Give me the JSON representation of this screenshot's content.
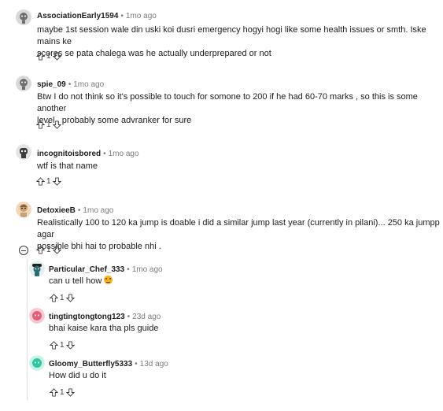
{
  "comments": [
    {
      "user": "AssociationEarly1594",
      "time": "1mo ago",
      "text_lines": [
        "maybe 1st session wale din uski koi dusri emergency hogyi hogi like some health issues or smth. Iske mains ke",
        "scores se pata chalega was he actually underprepared or not"
      ],
      "votes": "1",
      "avatar_color": "#6e6e6e"
    },
    {
      "user": "spie_09",
      "time": "1mo ago",
      "text_lines": [
        "Btw I do not think so it's possible to touch for somone to 200 if he had 60-70 marks , so this is some another",
        "level , probably some advranker for sure"
      ],
      "votes": "1",
      "avatar_color": "#6e6e6e"
    },
    {
      "user": "incognitoisbored",
      "time": "1mo ago",
      "text_lines": [
        "wtf is that name"
      ],
      "votes": "1",
      "avatar_color": "#3a3a3a"
    },
    {
      "user": "DetoxieeB",
      "time": "1mo ago",
      "text_lines": [
        "Realistically 100 to 120 ka jump is doable i did a similar jump last year (currently in pilani)... 250 ka jumpp agar",
        "possible bhi hai to probable nhi ."
      ],
      "votes": "1",
      "avatar_color": "#c8a07a"
    },
    {
      "user": "Particular_Chef_333",
      "time": "1mo ago",
      "text_lines": [
        "can u tell how"
      ],
      "votes": "1",
      "avatar_color": "#2c6b73"
    },
    {
      "user": "tingtingtongtong123",
      "time": "23d ago",
      "text_lines": [
        "bhai kaise kara tha pls guide"
      ],
      "votes": "1",
      "avatar_color": "#e0607a"
    },
    {
      "user": "Gloomy_Butterfly5333",
      "time": "13d ago",
      "text_lines": [
        "How did u do it"
      ],
      "votes": "1",
      "avatar_color": "#2fc7a0"
    }
  ],
  "separator": "•"
}
